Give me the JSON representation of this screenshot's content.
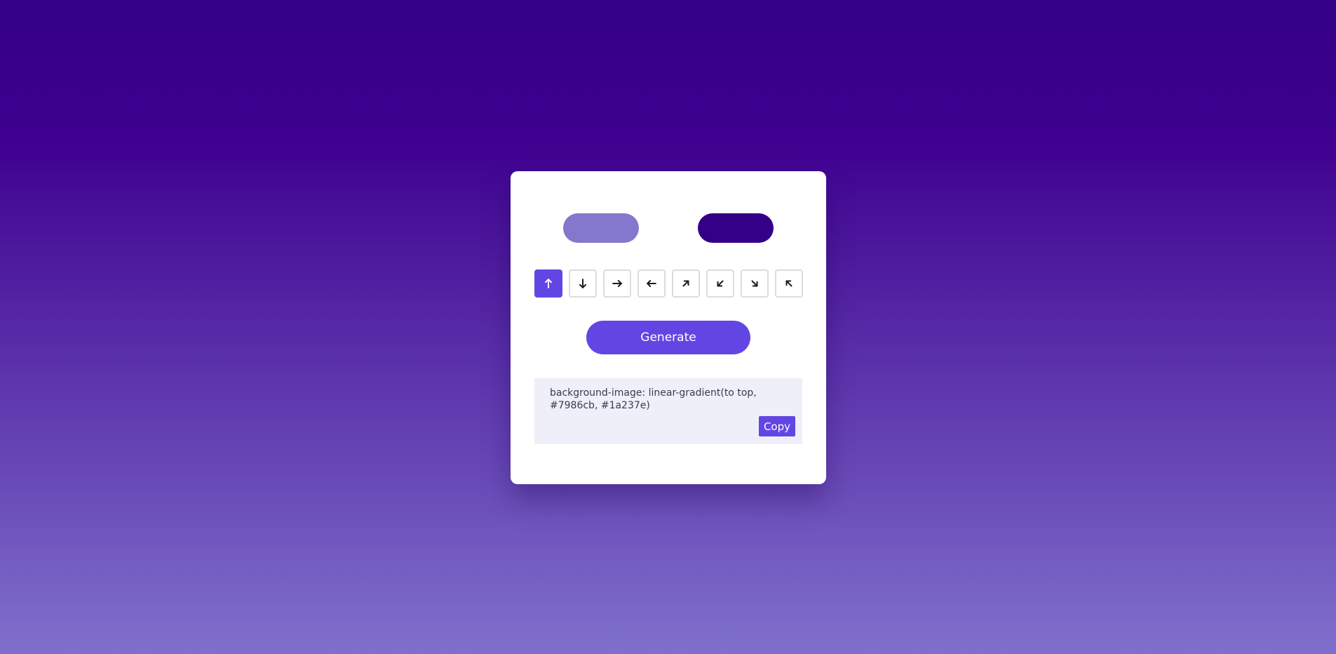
{
  "colors": {
    "bg_top": "#330087",
    "bg_mid": "#3f0190",
    "bg_bottom": "#7f70cc",
    "accent": "#6246e4",
    "color_one": "#7986cb",
    "color_two": "#1a237e",
    "swatch_one_display": "#8378cc",
    "swatch_two_display": "#330087",
    "code_bg": "#efeffa",
    "icon_dark": "#1a1a1a",
    "icon_light": "#ffffff"
  },
  "directions": [
    {
      "name": "to top",
      "icon": "arrow-up-icon",
      "angle": 0,
      "active": true
    },
    {
      "name": "to bottom",
      "icon": "arrow-down-icon",
      "angle": 180,
      "active": false
    },
    {
      "name": "to right",
      "icon": "arrow-right-icon",
      "angle": 90,
      "active": false
    },
    {
      "name": "to left",
      "icon": "arrow-left-icon",
      "angle": 270,
      "active": false
    },
    {
      "name": "to top right",
      "icon": "arrow-up-right-icon",
      "angle": 45,
      "active": false
    },
    {
      "name": "to bottom left",
      "icon": "arrow-down-left-icon",
      "angle": 225,
      "active": false
    },
    {
      "name": "to bottom right",
      "icon": "arrow-down-right-icon",
      "angle": 135,
      "active": false
    },
    {
      "name": "to top left",
      "icon": "arrow-up-left-icon",
      "angle": 315,
      "active": false
    }
  ],
  "generate_label": "Generate",
  "output": {
    "code": "background-image: linear-gradient(to top, #7986cb, #1a237e)",
    "copy_label": "Copy"
  }
}
